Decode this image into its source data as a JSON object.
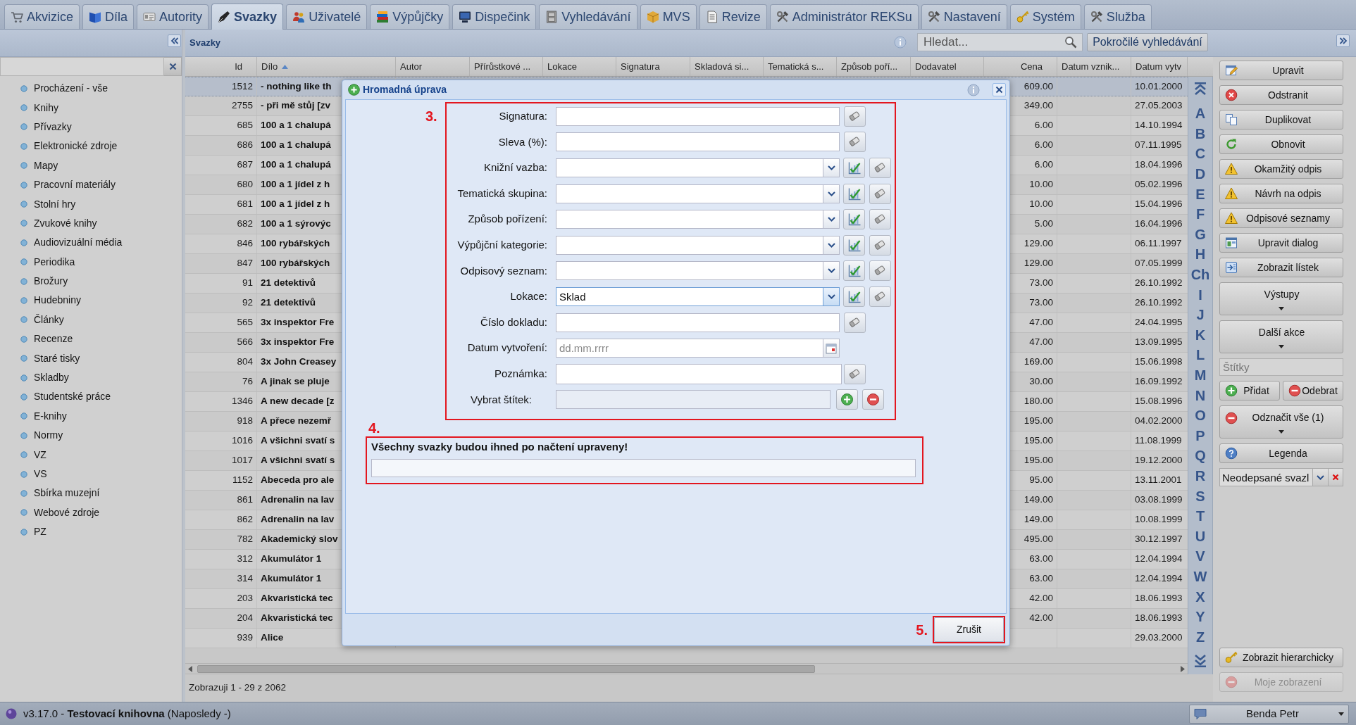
{
  "tabs": [
    {
      "label": "Akvizice",
      "selected": false
    },
    {
      "label": "Díla",
      "selected": false
    },
    {
      "label": "Autority",
      "selected": false
    },
    {
      "label": "Svazky",
      "selected": true
    },
    {
      "label": "Uživatelé",
      "selected": false
    },
    {
      "label": "Výpůjčky",
      "selected": false
    },
    {
      "label": "Dispečink",
      "selected": false
    },
    {
      "label": "Vyhledávání",
      "selected": false
    },
    {
      "label": "MVS",
      "selected": false
    },
    {
      "label": "Revize",
      "selected": false
    },
    {
      "label": "Administrátor REKSu",
      "selected": false
    },
    {
      "label": "Nastavení",
      "selected": false
    },
    {
      "label": "Systém",
      "selected": false
    },
    {
      "label": "Služba",
      "selected": false
    }
  ],
  "sidebar": {
    "items": [
      "Procházení - vše",
      "Knihy",
      "Přívazky",
      "Elektronické zdroje",
      "Mapy",
      "Pracovní materiály",
      "Stolní hry",
      "Zvukové knihy",
      "Audiovizuální média",
      "Periodika",
      "Brožury",
      "Hudebniny",
      "Články",
      "Recenze",
      "Staré tisky",
      "Skladby",
      "Studentské práce",
      "E-knihy",
      "Normy",
      "VZ",
      "VS",
      "Sbírka muzejní",
      "Webové zdroje",
      "PZ"
    ]
  },
  "panel": {
    "title": "Svazky",
    "search": {
      "placeholder": "Hledat..."
    },
    "advanced_search": "Pokročilé vyhledávání"
  },
  "table": {
    "columns": [
      {
        "label": "Id",
        "sorted": false
      },
      {
        "label": "Dílo",
        "sorted": true
      },
      {
        "label": "Autor",
        "sorted": false
      },
      {
        "label": "Přírůstkové ...",
        "sorted": false
      },
      {
        "label": "Lokace",
        "sorted": false
      },
      {
        "label": "Signatura",
        "sorted": false
      },
      {
        "label": "Skladová si...",
        "sorted": false
      },
      {
        "label": "Tematická s...",
        "sorted": false
      },
      {
        "label": "Způsob poří...",
        "sorted": false
      },
      {
        "label": "Dodavatel",
        "sorted": false
      },
      {
        "label": "Cena",
        "sorted": false
      },
      {
        "label": "Datum vznik...",
        "sorted": false
      },
      {
        "label": "Datum vytv",
        "sorted": false
      }
    ],
    "rows": [
      {
        "id": "1512",
        "work": "- nothing like th",
        "price": "609.00",
        "column_13": "10.01.2000",
        "selected": true
      },
      {
        "id": "2755",
        "work": "- při mě stůj [zv",
        "price": "349.00",
        "column_13": "27.05.2003",
        "selected": false
      },
      {
        "id": "685",
        "work": "100 a 1 chalupá",
        "price": "6.00",
        "column_13": "14.10.1994",
        "selected": false
      },
      {
        "id": "686",
        "work": "100 a 1 chalupá",
        "price": "6.00",
        "column_13": "07.11.1995",
        "selected": false
      },
      {
        "id": "687",
        "work": "100 a 1 chalupá",
        "price": "6.00",
        "column_13": "18.04.1996",
        "selected": false
      },
      {
        "id": "680",
        "work": "100 a 1 jídel z h",
        "price": "10.00",
        "column_13": "05.02.1996",
        "selected": false
      },
      {
        "id": "681",
        "work": "100 a 1 jídel z h",
        "price": "10.00",
        "column_13": "15.04.1996",
        "selected": false
      },
      {
        "id": "682",
        "work": "100 a 1 sýrovýc",
        "price": "5.00",
        "column_13": "16.04.1996",
        "selected": false
      },
      {
        "id": "846",
        "work": "100 rybářských",
        "price": "129.00",
        "column_13": "06.11.1997",
        "selected": false
      },
      {
        "id": "847",
        "work": "100 rybářských",
        "price": "129.00",
        "column_13": "07.05.1999",
        "selected": false
      },
      {
        "id": "91",
        "work": "21 detektivů",
        "price": "73.00",
        "column_13": "26.10.1992",
        "selected": false
      },
      {
        "id": "92",
        "work": "21 detektivů",
        "price": "73.00",
        "column_13": "26.10.1992",
        "selected": false
      },
      {
        "id": "565",
        "work": "3x inspektor Fre",
        "price": "47.00",
        "column_13": "24.04.1995",
        "selected": false
      },
      {
        "id": "566",
        "work": "3x inspektor Fre",
        "price": "47.00",
        "column_13": "13.09.1995",
        "selected": false
      },
      {
        "id": "804",
        "work": "3x John Creasey",
        "price": "169.00",
        "column_13": "15.06.1998",
        "selected": false
      },
      {
        "id": "76",
        "work": "A jinak se pluje",
        "price": "30.00",
        "column_13": "16.09.1992",
        "selected": false
      },
      {
        "id": "1346",
        "work": "A new decade [z",
        "price": "180.00",
        "column_13": "15.08.1996",
        "selected": false
      },
      {
        "id": "918",
        "work": "A přece nezemř",
        "price": "195.00",
        "column_13": "04.02.2000",
        "selected": false
      },
      {
        "id": "1016",
        "work": "A všichni svatí s",
        "price": "195.00",
        "column_13": "11.08.1999",
        "selected": false
      },
      {
        "id": "1017",
        "work": "A všichni svatí s",
        "price": "195.00",
        "column_13": "19.12.2000",
        "selected": false
      },
      {
        "id": "1152",
        "work": "Abeceda pro ale",
        "price": "95.00",
        "column_13": "13.11.2001",
        "selected": false
      },
      {
        "id": "861",
        "work": "Adrenalin na lav",
        "price": "149.00",
        "column_13": "03.08.1999",
        "selected": false
      },
      {
        "id": "862",
        "work": "Adrenalin na lav",
        "price": "149.00",
        "column_13": "10.08.1999",
        "selected": false
      },
      {
        "id": "782",
        "work": "Akademický slov",
        "price": "495.00",
        "column_13": "30.12.1997",
        "selected": false
      },
      {
        "id": "312",
        "work": "Akumulátor 1",
        "price": "63.00",
        "column_13": "12.04.1994",
        "selected": false
      },
      {
        "id": "314",
        "work": "Akumulátor 1",
        "price": "63.00",
        "column_13": "12.04.1994",
        "selected": false
      },
      {
        "id": "203",
        "work": "Akvaristická tec",
        "price": "42.00",
        "column_13": "18.06.1993",
        "selected": false
      },
      {
        "id": "204",
        "work": "Akvaristická tec",
        "price": "42.00",
        "column_13": "18.06.1993",
        "selected": false
      },
      {
        "id": "939",
        "work": "Alice",
        "column_13": "29.03.2000",
        "selected": false
      }
    ],
    "paging": "Zobrazuji 1 - 29 z 2062"
  },
  "alphabet": [
    "A",
    "B",
    "C",
    "D",
    "E",
    "F",
    "G",
    "H",
    "Ch",
    "I",
    "J",
    "K",
    "L",
    "M",
    "N",
    "O",
    "P",
    "Q",
    "R",
    "S",
    "T",
    "U",
    "V",
    "W",
    "X",
    "Y",
    "Z"
  ],
  "actions": [
    {
      "kind": "button",
      "label": "Upravit",
      "disabled": false
    },
    {
      "kind": "button",
      "label": "Odstranit",
      "disabled": false
    },
    {
      "kind": "button",
      "label": "Duplikovat",
      "disabled": false
    },
    {
      "kind": "button",
      "label": "Obnovit",
      "disabled": false
    },
    {
      "kind": "button",
      "label": "Okamžitý odpis",
      "disabled": false
    },
    {
      "kind": "button",
      "label": "Návrh na odpis",
      "disabled": false
    },
    {
      "kind": "button",
      "label": "Odpisové seznamy",
      "disabled": false
    },
    {
      "kind": "button",
      "label": "Upravit dialog",
      "disabled": false
    },
    {
      "kind": "button",
      "label": "Zobrazit lístek",
      "disabled": false
    },
    {
      "kind": "menu",
      "label": "Výstupy",
      "disabled": false
    },
    {
      "kind": "menu",
      "label": "Další akce",
      "disabled": false
    },
    {
      "kind": "field",
      "placeholder": "Štítky"
    },
    {
      "kind": "pair",
      "buttons": [
        {
          "label": "Přidat",
          "disabled": false
        },
        {
          "label": "Odebrat",
          "disabled": false
        }
      ]
    },
    {
      "kind": "menu",
      "label": "Odznačit vše (1)",
      "disabled": false
    },
    {
      "kind": "button",
      "label": "Legenda",
      "disabled": false
    },
    {
      "kind": "select",
      "value": "Neodepsané svazl"
    }
  ],
  "bottom_actions": [
    {
      "kind": "button",
      "label": "Zobrazit hierarchicky",
      "disabled": false
    },
    {
      "kind": "button",
      "label": "Moje zobrazení",
      "disabled": true
    }
  ],
  "dialog": {
    "title": "Hromadná úprava",
    "form": {
      "callout": "3.",
      "fields": [
        {
          "kind": "text",
          "label": "Signatura:",
          "focused": false
        },
        {
          "kind": "text",
          "label": "Sleva (%):",
          "focused": false
        },
        {
          "kind": "combo",
          "label": "Knižní vazba:",
          "focused": false
        },
        {
          "kind": "combo",
          "label": "Tematická skupina:",
          "focused": false
        },
        {
          "kind": "combo",
          "label": "Způsob pořízení:",
          "focused": false
        },
        {
          "kind": "combo",
          "label": "Výpůjční kategorie:",
          "focused": false
        },
        {
          "kind": "combo",
          "label": "Odpisový seznam:",
          "focused": false
        },
        {
          "kind": "combo",
          "label": "Lokace:",
          "value": "Sklad",
          "focused": true
        },
        {
          "kind": "text",
          "label": "Číslo dokladu:",
          "focused": false
        },
        {
          "kind": "date",
          "label": "Datum vytvoření:",
          "placeholder": "dd.mm.rrrr",
          "focused": false
        },
        {
          "kind": "textarea",
          "label": "Poznámka:",
          "focused": false
        },
        {
          "kind": "tags",
          "label": "Vybrat štítek:",
          "focused": false
        }
      ]
    },
    "notice": {
      "callout": "4.",
      "text": "Všechny svazky budou ihned po načtení upraveny!",
      "progress": {
        "level": 0
      }
    },
    "footer": {
      "callout": "5.",
      "cancel": "Zrušit"
    }
  },
  "status_bar": {
    "version": "v3.17.0 - **Testovací knihovna** (Naposledy -)",
    "user": "Benda Petr"
  }
}
